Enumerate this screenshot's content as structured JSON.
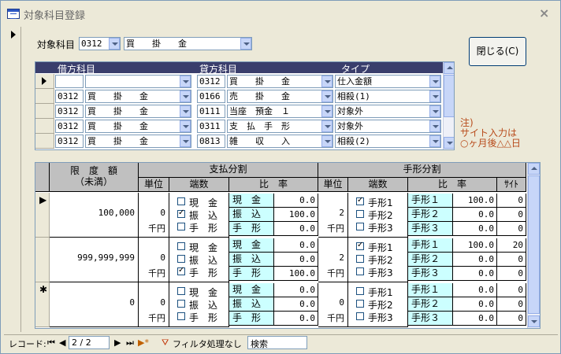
{
  "window": {
    "title": "対象科目登録"
  },
  "header": {
    "subject_label": "対象科目",
    "subject_code": "0312",
    "subject_name": "買　　掛　　金",
    "close_button": "閉じる(C)"
  },
  "grid1": {
    "headers": [
      "借方科目",
      "貸方科目",
      "タイプ"
    ],
    "rows": [
      {
        "d_code": "",
        "d_name": "",
        "c_code": "0312",
        "c_name": "買　　掛　　金",
        "type": "仕入金額"
      },
      {
        "d_code": "0312",
        "d_name": "買　　掛　　金",
        "c_code": "0166",
        "c_name": "売　　掛　　金",
        "type": "相殺(1)"
      },
      {
        "d_code": "0312",
        "d_name": "買　　掛　　金",
        "c_code": "0111",
        "c_name": "当座　預金　１",
        "type": "対象外"
      },
      {
        "d_code": "0312",
        "d_name": "買　　掛　　金",
        "c_code": "0311",
        "c_name": "支　払　手　形",
        "type": "対象外"
      },
      {
        "d_code": "0312",
        "d_name": "買　　掛　　金",
        "c_code": "0813",
        "c_name": "雑　　収　　入",
        "type": "相殺(2)"
      }
    ]
  },
  "note": "注)\nサイト入力は\n○ヶ月後△△日",
  "grid2": {
    "h_limit": "限　度　額\n（未満）",
    "h_pay": "支払分割",
    "h_bill": "手形分割",
    "h_unit": "単位",
    "h_frac": "端数",
    "h_ratio": "比　率",
    "h_site": "ｻｲﾄ",
    "unit_label": "千円",
    "pay_opts": [
      "現　金",
      "振　込",
      "手　形"
    ],
    "bill_opts": [
      "手形1",
      "手形2",
      "手形3"
    ],
    "pay_names": [
      "現　金",
      "振　込",
      "手　形"
    ],
    "bill_names": [
      "手形１",
      "手形２",
      "手形３"
    ],
    "rows": [
      {
        "limit": "100,000",
        "unit": "0",
        "pay_check": [
          false,
          true,
          false
        ],
        "pay_ratio": [
          "0.0",
          "100.0",
          "0.0"
        ],
        "bunit": "2",
        "bill_check": [
          true,
          false,
          false
        ],
        "bill_ratio": [
          "100.0",
          "0.0",
          "0.0"
        ],
        "site": [
          "0",
          "0",
          "0"
        ]
      },
      {
        "limit": "999,999,999",
        "unit": "0",
        "pay_check": [
          false,
          false,
          true
        ],
        "pay_ratio": [
          "0.0",
          "0.0",
          "100.0"
        ],
        "bunit": "2",
        "bill_check": [
          true,
          false,
          false
        ],
        "bill_ratio": [
          "100.0",
          "0.0",
          "0.0"
        ],
        "site": [
          "20",
          "0",
          "0"
        ]
      },
      {
        "limit": "0",
        "unit": "0",
        "pay_check": [
          false,
          false,
          false
        ],
        "pay_ratio": [
          "0.0",
          "0.0",
          "0.0"
        ],
        "bunit": "0",
        "bill_check": [
          false,
          false,
          false
        ],
        "bill_ratio": [
          "0.0",
          "0.0",
          "0.0"
        ],
        "site": [
          "0",
          "0",
          "0"
        ]
      }
    ]
  },
  "status": {
    "record_label": "レコード:",
    "record_value": "2 / 2",
    "filter": "フィルタ処理なし",
    "search": "検索"
  }
}
